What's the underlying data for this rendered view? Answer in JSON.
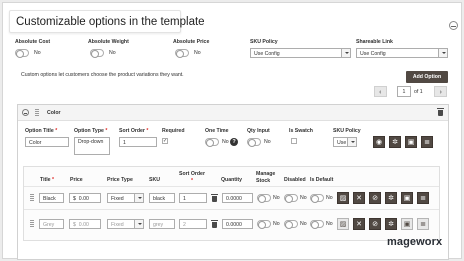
{
  "header": {
    "title": "Customizable options in the template"
  },
  "settings": {
    "absolute_cost": {
      "label": "Absolute Cost",
      "value": "No"
    },
    "absolute_weight": {
      "label": "Absolute Weight",
      "value": "No"
    },
    "absolute_price": {
      "label": "Absolute Price",
      "value": "No"
    },
    "sku_policy": {
      "label": "SKU Policy",
      "value": "Use Config"
    },
    "shareable_link": {
      "label": "Shareable Link",
      "value": "Use Config"
    }
  },
  "info_text": "Custom options let customers choose the product variations they want.",
  "add_option_label": "Add Option",
  "pager": {
    "page": "1",
    "of_label": "of 1"
  },
  "option": {
    "title": "Color",
    "columns": {
      "option_title": "Option Title",
      "option_type": "Option Type",
      "sort_order": "Sort Order",
      "required": "Required",
      "one_time": "One Time",
      "qty_input": "Qty Input",
      "is_swatch": "Is Swatch",
      "sku_policy": "SKU Policy"
    },
    "values": {
      "option_title": "Color",
      "option_type": "Drop-down",
      "sort_order": "1",
      "required_mark": "✓",
      "one_time": "No",
      "qty_input": "No",
      "sku_policy": "Use Cc"
    }
  },
  "values_table": {
    "headers": {
      "title": "Title",
      "price": "Price",
      "price_type": "Price Type",
      "sku": "SKU",
      "sort_order": "Sort Order",
      "quantity": "Quantity",
      "manage_stock": "Manage Stock",
      "disabled": "Disabled",
      "is_default": "Is Default"
    },
    "rows": [
      {
        "title": "Black",
        "currency": "$",
        "price": "0.00",
        "price_type": "Fixed",
        "sku": "black",
        "sort_order": "1",
        "quantity": "0.0000",
        "manage_stock": "No",
        "disabled": "No",
        "is_default": "No"
      },
      {
        "title": "Grey",
        "currency": "$",
        "price": "0.00",
        "price_type": "Fixed",
        "sku": "grey",
        "sort_order": "2",
        "quantity": "0.0000",
        "manage_stock": "No",
        "disabled": "No",
        "is_default": "No"
      }
    ]
  },
  "brand": "mageworx",
  "colors": {
    "accent_button": "#514943",
    "required": "#e02b27"
  }
}
